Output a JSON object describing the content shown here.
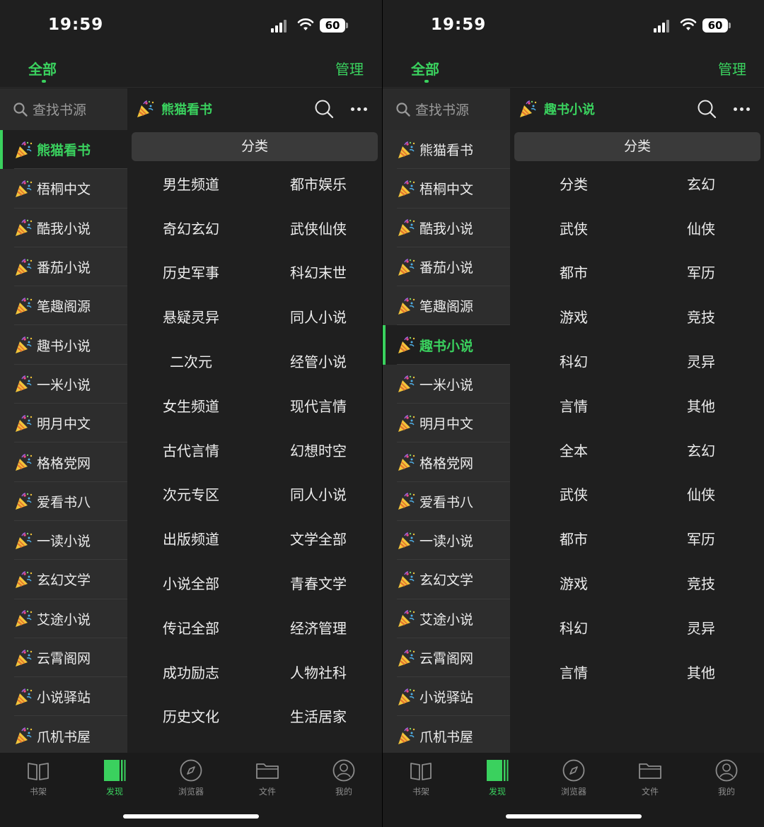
{
  "status_bar": {
    "time": "19:59",
    "battery": "60"
  },
  "header": {
    "tab_all": "全部",
    "manage": "管理"
  },
  "sidebar": {
    "search_placeholder": "查找书源",
    "items": [
      "熊猫看书",
      "梧桐中文",
      "酷我小说",
      "番茄小说",
      "笔趣阁源",
      "趣书小说",
      "一米小说",
      "明月中文",
      "格格党网",
      "爱看书八",
      "一读小说",
      "玄幻文学",
      "艾途小说",
      "云霄阁网",
      "小说驿站",
      "爪机书屋"
    ]
  },
  "screens": [
    {
      "active_source": "熊猫看书",
      "category_header": "分类",
      "categories": [
        [
          "男生频道",
          "都市娱乐"
        ],
        [
          "奇幻玄幻",
          "武侠仙侠"
        ],
        [
          "历史军事",
          "科幻末世"
        ],
        [
          "悬疑灵异",
          "同人小说"
        ],
        [
          "二次元",
          "经管小说"
        ],
        [
          "女生频道",
          "现代言情"
        ],
        [
          "古代言情",
          "幻想时空"
        ],
        [
          "次元专区",
          "同人小说"
        ],
        [
          "出版频道",
          "文学全部"
        ],
        [
          "小说全部",
          "青春文学"
        ],
        [
          "传记全部",
          "经济管理"
        ],
        [
          "成功励志",
          "人物社科"
        ],
        [
          "历史文化",
          "生活居家"
        ]
      ]
    },
    {
      "active_source": "趣书小说",
      "category_header": "分类",
      "categories": [
        [
          "分类",
          "玄幻"
        ],
        [
          "武侠",
          "仙侠"
        ],
        [
          "都市",
          "军历"
        ],
        [
          "游戏",
          "竞技"
        ],
        [
          "科幻",
          "灵异"
        ],
        [
          "言情",
          "其他"
        ],
        [
          "全本",
          "玄幻"
        ],
        [
          "武侠",
          "仙侠"
        ],
        [
          "都市",
          "军历"
        ],
        [
          "游戏",
          "竞技"
        ],
        [
          "科幻",
          "灵异"
        ],
        [
          "言情",
          "其他"
        ]
      ]
    }
  ],
  "bottom_nav": [
    {
      "label": "书架",
      "icon": "bookshelf-icon"
    },
    {
      "label": "发现",
      "icon": "discover-icon"
    },
    {
      "label": "浏览器",
      "icon": "compass-icon"
    },
    {
      "label": "文件",
      "icon": "folder-icon"
    },
    {
      "label": "我的",
      "icon": "profile-icon"
    }
  ],
  "colors": {
    "accent": "#3ad15e",
    "background": "#1f1f1f",
    "sidebar": "#2b2b2b"
  }
}
